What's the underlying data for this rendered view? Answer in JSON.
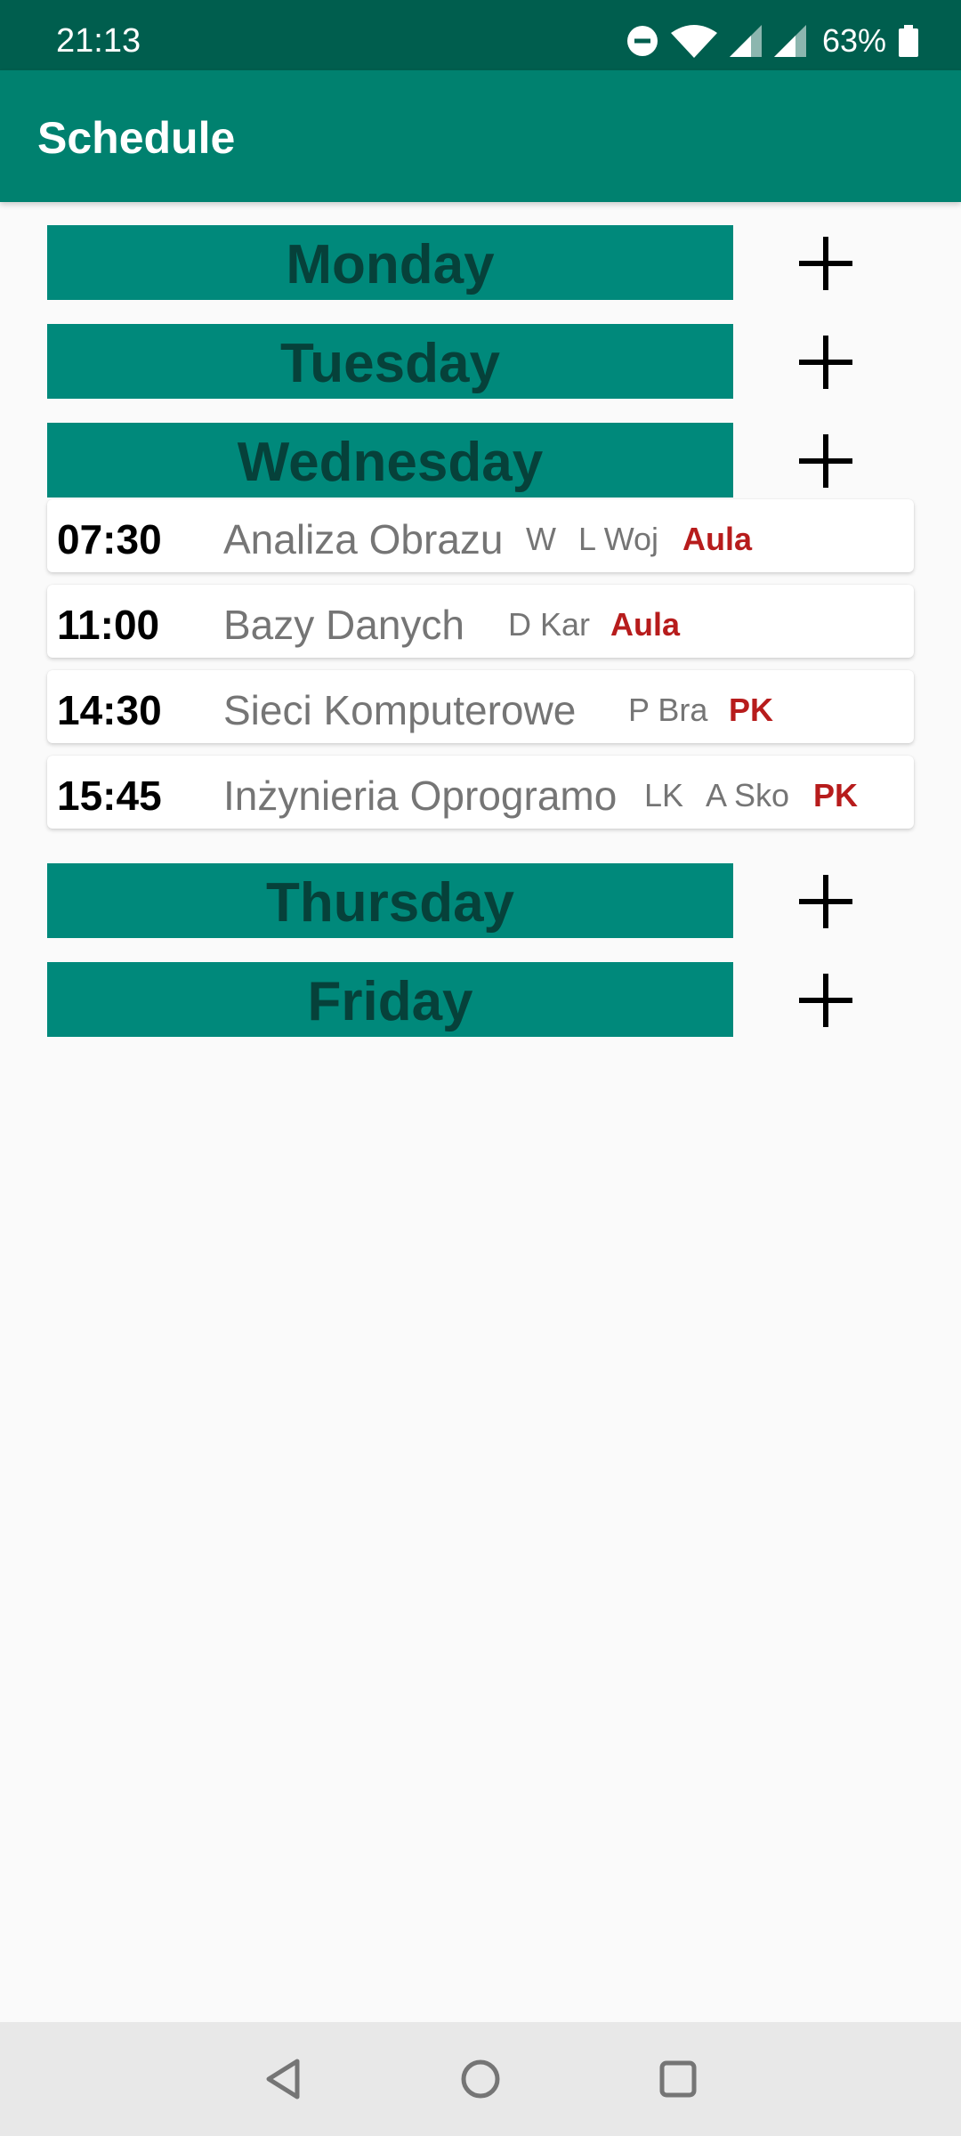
{
  "status_bar": {
    "time": "21:13",
    "battery": "63%",
    "icons": [
      "do-not-disturb-icon",
      "wifi-icon",
      "signal-icon",
      "signal-icon",
      "battery-icon"
    ]
  },
  "app_bar": {
    "title": "Schedule"
  },
  "colors": {
    "status_bar": "#005E4E",
    "app_bar": "#00816F",
    "day_header": "#00897B",
    "day_header_text": "#06413A",
    "room_text": "#B71C1C"
  },
  "days": [
    {
      "name": "Monday",
      "add_icon": "plus-icon"
    },
    {
      "name": "Tuesday",
      "add_icon": "plus-icon"
    },
    {
      "name": "Wednesday",
      "add_icon": "plus-icon"
    },
    {
      "name": "Thursday",
      "add_icon": "plus-icon"
    },
    {
      "name": "Friday",
      "add_icon": "plus-icon"
    }
  ],
  "wednesday_classes": [
    {
      "time": "07:30",
      "name": "Analiza Obrazu",
      "type": "W",
      "teacher": "L Woj",
      "room": "Aula"
    },
    {
      "time": "11:00",
      "name": "Bazy Danych",
      "type": "",
      "teacher": "D Kar",
      "room": "Aula"
    },
    {
      "time": "14:30",
      "name": "Sieci Komputerowe",
      "type": "",
      "teacher": "P Bra",
      "room": "PK"
    },
    {
      "time": "15:45",
      "name": "Inżynieria Oprogramo",
      "type": "LK",
      "teacher": "A Sko",
      "room": "PK"
    }
  ],
  "nav_bar": {
    "icons": [
      "back-icon",
      "home-icon",
      "recents-icon"
    ]
  }
}
